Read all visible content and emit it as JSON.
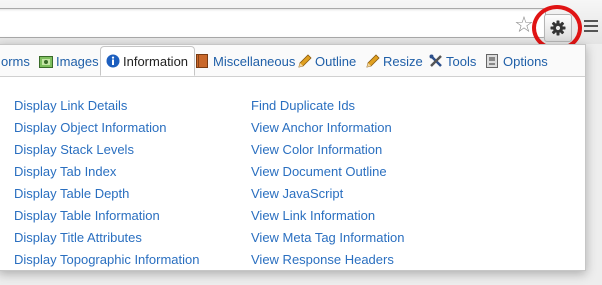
{
  "tabs": [
    {
      "label": "orms",
      "icon": "forms-icon"
    },
    {
      "label": "Images",
      "icon": "images-icon"
    },
    {
      "label": "Information",
      "icon": "information-icon",
      "active": true
    },
    {
      "label": "Miscellaneous",
      "icon": "book-icon"
    },
    {
      "label": "Outline",
      "icon": "pencil-icon"
    },
    {
      "label": "Resize",
      "icon": "pencil-icon"
    },
    {
      "label": "Tools",
      "icon": "tools-icon"
    },
    {
      "label": "Options",
      "icon": "options-icon"
    }
  ],
  "menu": {
    "left": [
      "Display Link Details",
      "Display Object Information",
      "Display Stack Levels",
      "Display Tab Index",
      "Display Table Depth",
      "Display Table Information",
      "Display Title Attributes",
      "Display Topographic Information"
    ],
    "right": [
      "Find Duplicate Ids",
      "View Anchor Information",
      "View Color Information",
      "View Document Outline",
      "View JavaScript",
      "View Link Information",
      "View Meta Tag Information",
      "View Response Headers"
    ]
  },
  "colors": {
    "link": "#2a6fc0",
    "highlight": "#e01414"
  }
}
